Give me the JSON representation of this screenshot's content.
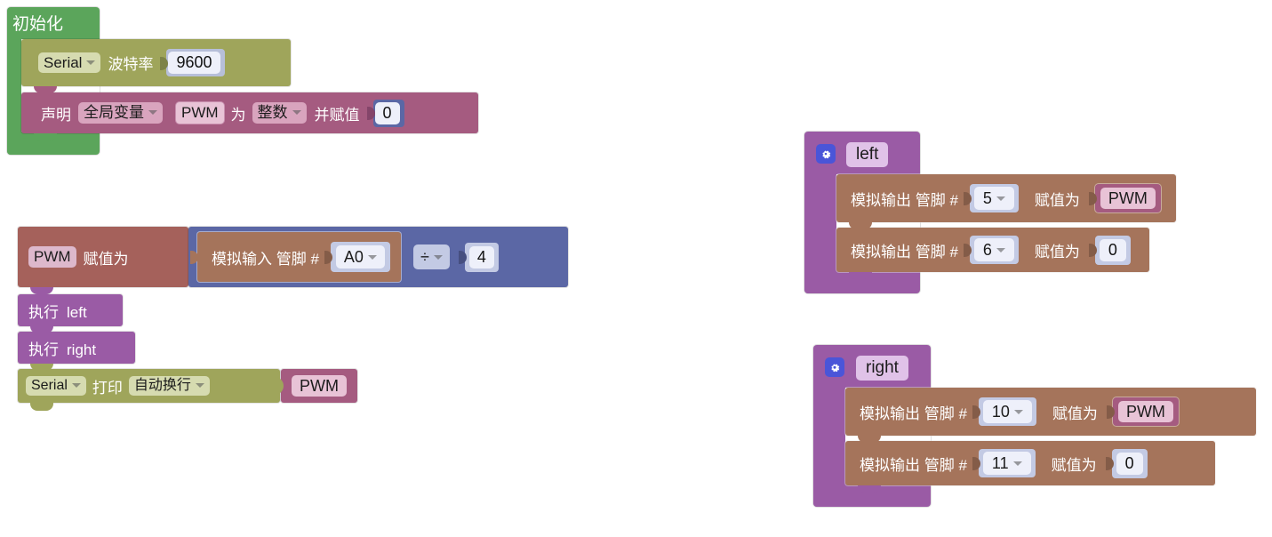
{
  "app": {
    "kind": "blockly-visual-programming",
    "language": "zh-CN"
  },
  "colors": {
    "setup_green": "#5BA55B",
    "serial_olive": "#9FA55B",
    "variable_pink": "#A5615B",
    "variable_magenta": "#A55B80",
    "math_blue": "#5B67A5",
    "io_brown": "#A5745B",
    "procedure_purple": "#9A5BA5",
    "field_light": "#E8EAF6",
    "gear_blue": "#4A55D8"
  },
  "setup_stack": {
    "hat_label": "初始化",
    "rows": [
      {
        "id": "serial-begin",
        "port_label": "Serial",
        "text": "波特率",
        "baud_value": "9600"
      },
      {
        "id": "declare-variable",
        "declare_label": "声明",
        "scope_value": "全局变量",
        "var_name": "PWM",
        "as_label": "为",
        "type_value": "整数",
        "assign_label": "并赋值",
        "init_value": "0"
      }
    ]
  },
  "loop_stack": {
    "rows": [
      {
        "id": "set-pwm",
        "var_name": "PWM",
        "text": "赋值为",
        "expression": {
          "analog_read_label": "模拟输入 管脚 #",
          "pin_value": "A0",
          "operator": "÷",
          "operand": "4"
        }
      },
      {
        "id": "call-left",
        "call_label": "执行",
        "proc_name": "left"
      },
      {
        "id": "call-right",
        "call_label": "执行",
        "proc_name": "right"
      },
      {
        "id": "serial-print",
        "port_label": "Serial",
        "print_label": "打印",
        "mode_value": "自动换行",
        "argument": "PWM"
      }
    ]
  },
  "procedures": [
    {
      "id": "proc-left",
      "gear_icon": "gear-icon",
      "name": "left",
      "rows": [
        {
          "label": "模拟输出 管脚 #",
          "pin_value": "5",
          "assign_label": "赋值为",
          "value": "PWM",
          "value_kind": "variable"
        },
        {
          "label": "模拟输出 管脚 #",
          "pin_value": "6",
          "assign_label": "赋值为",
          "value": "0",
          "value_kind": "number"
        }
      ]
    },
    {
      "id": "proc-right",
      "gear_icon": "gear-icon",
      "name": "right",
      "rows": [
        {
          "label": "模拟输出 管脚 #",
          "pin_value": "10",
          "assign_label": "赋值为",
          "value": "PWM",
          "value_kind": "variable"
        },
        {
          "label": "模拟输出 管脚 #",
          "pin_value": "11",
          "assign_label": "赋值为",
          "value": "0",
          "value_kind": "number"
        }
      ]
    }
  ]
}
